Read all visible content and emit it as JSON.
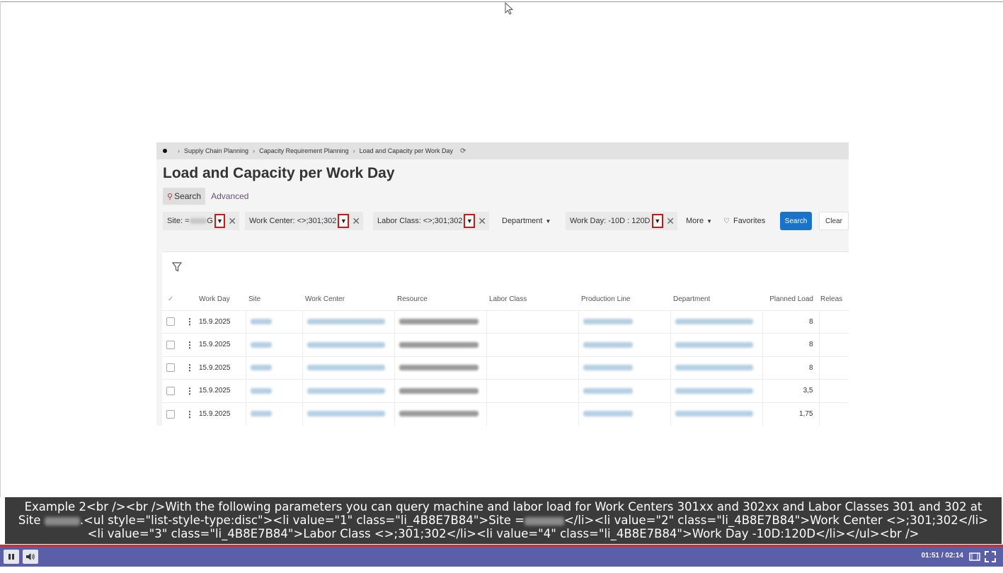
{
  "breadcrumb": [
    "Supply Chain Planning",
    "Capacity Requirement Planning",
    "Load and Capacity per Work Day"
  ],
  "page_title": "Load and Capacity per Work Day",
  "tabs": {
    "search": "Search",
    "advanced": "Advanced"
  },
  "filters": {
    "site_prefix": "Site: =",
    "site_suffix": "G",
    "work_center": "Work Center: <>;301;302",
    "labor_class": "Labor Class: <>;301;302",
    "department": "Department",
    "work_day": "Work Day: -10D : 120D",
    "more": "More",
    "favorites": "Favorites",
    "search_button": "Search",
    "clear_button": "Clear"
  },
  "grid": {
    "columns": [
      "Work Day",
      "Site",
      "Work Center",
      "Resource",
      "Labor Class",
      "Production Line",
      "Department",
      "Planned Load",
      "Releas"
    ],
    "rows": [
      {
        "work_day": "15.9.2025",
        "planned_load": "8"
      },
      {
        "work_day": "15.9.2025",
        "planned_load": "8"
      },
      {
        "work_day": "15.9.2025",
        "planned_load": "8"
      },
      {
        "work_day": "15.9.2025",
        "planned_load": "3,5"
      },
      {
        "work_day": "15.9.2025",
        "planned_load": "1,75"
      }
    ]
  },
  "caption": {
    "part1": "Example 2<br /><br />With the following parameters you can query machine and labor load for Work Centers 301xx and 302xx and Labor Classes 301 and 302 at Site",
    "part2": ".<ul style=\"list-style-type:disc\"><li value=\"1\" class=\"li_4B8E7B84\">Site =",
    "part3": "</li><li value=\"2\" class=\"li_4B8E7B84\">Work Center <>;301;302</li><li value=\"3\" class=\"li_4B8E7B84\">Labor Class <>;301;302</li><li value=\"4\" class=\"li_4B8E7B84\">Work Day -10D:120D</li></ul><br />"
  },
  "player": {
    "time": "01:51 / 02:14",
    "progress": 0.83
  },
  "colors": {
    "accent": "#1a73c8",
    "highlight": "#c41a1a",
    "player_bar": "#5a5fa8",
    "caption_bg": "#3b3b3b"
  },
  "icons": [
    "cursor-icon",
    "refresh-icon",
    "search-icon",
    "chevron-down-icon",
    "close-icon",
    "heart-icon",
    "filter-icon",
    "pause-icon",
    "volume-icon",
    "theater-mode-icon",
    "fullscreen-icon"
  ]
}
